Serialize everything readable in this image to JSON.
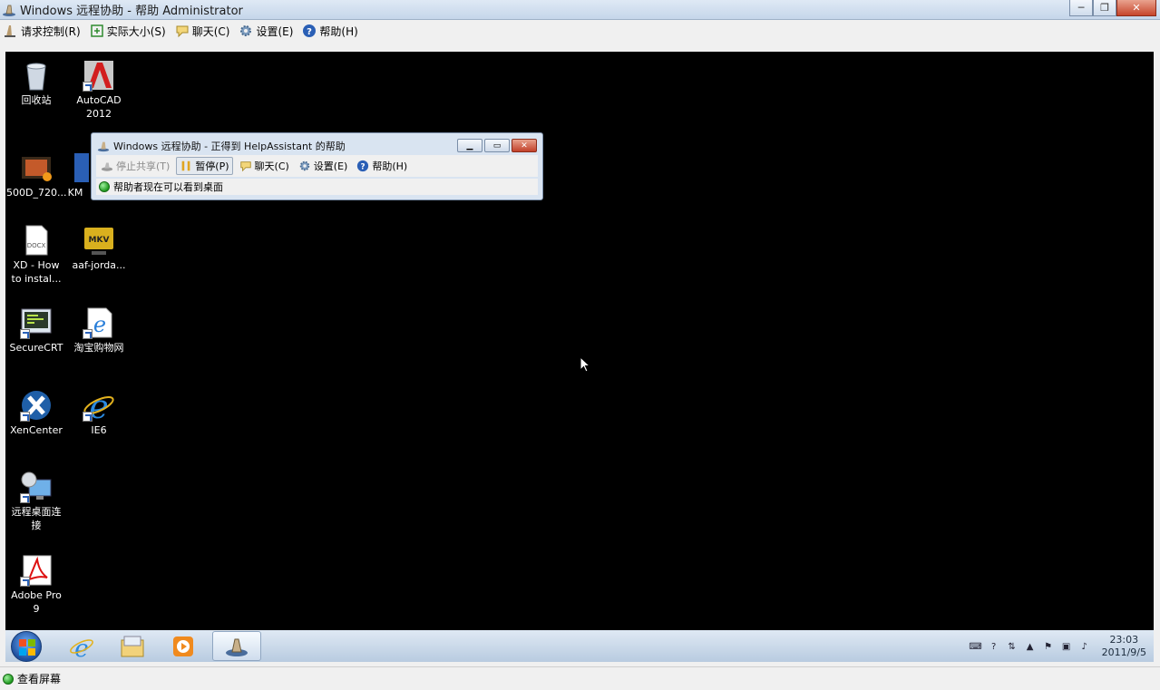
{
  "window": {
    "title": "Windows 远程协助 - 帮助 Administrator",
    "controls": {
      "minimize": "─",
      "restore": "❐",
      "close": "✕"
    }
  },
  "menubar": {
    "items": [
      {
        "label": "请求控制(R)",
        "icon": "request-control-icon"
      },
      {
        "label": "实际大小(S)",
        "icon": "actual-size-icon"
      },
      {
        "label": "聊天(C)",
        "icon": "chat-icon"
      },
      {
        "label": "设置(E)",
        "icon": "gear-icon"
      },
      {
        "label": "帮助(H)",
        "icon": "help-icon"
      }
    ]
  },
  "desktop_icons": [
    {
      "label": "回收站",
      "icon": "recycle-bin-icon"
    },
    {
      "label": "AutoCAD\n2012",
      "icon": "autocad-icon"
    },
    {
      "label": "500D_720...",
      "icon": "video-file-icon"
    },
    {
      "label": "KM",
      "icon": "km-icon"
    },
    {
      "label": "XD - How\nto instal...",
      "icon": "docx-file-icon"
    },
    {
      "label": "aaf-jorda...",
      "icon": "mkv-file-icon"
    },
    {
      "label": "SecureCRT",
      "icon": "securecrt-icon"
    },
    {
      "label": "淘宝购物网",
      "icon": "ie-icon"
    },
    {
      "label": "XenCenter",
      "icon": "xencenter-icon"
    },
    {
      "label": "IE6",
      "icon": "ie-icon"
    },
    {
      "label": "远程桌面连\n接",
      "icon": "remote-desktop-icon"
    },
    {
      "label": "Adobe Pro\n9",
      "icon": "adobe-pdf-icon"
    }
  ],
  "inner_window": {
    "title": "Windows 远程协助 - 正得到 HelpAssistant 的帮助",
    "toolbar": [
      {
        "label": "停止共享(T)",
        "icon": "stop-share-icon",
        "state": "disabled"
      },
      {
        "label": "暂停(P)",
        "icon": "pause-icon",
        "state": "active"
      },
      {
        "label": "聊天(C)",
        "icon": "chat-icon",
        "state": "normal"
      },
      {
        "label": "设置(E)",
        "icon": "gear-icon",
        "state": "normal"
      },
      {
        "label": "帮助(H)",
        "icon": "help-icon",
        "state": "normal"
      }
    ],
    "status": "帮助者现在可以看到桌面"
  },
  "taskbar": {
    "items": [
      "ie-icon",
      "file-explorer-icon",
      "media-player-icon",
      "remote-assistance-icon"
    ],
    "clock_time": "23:03",
    "clock_date": "2011/9/5"
  },
  "statusbar": {
    "text": "查看屏幕"
  },
  "colors": {
    "desktop_bg": "#000000",
    "titlebar": "#c5d6ea",
    "taskbar": "#b8cbe0",
    "status_green": "#1f9a1f"
  }
}
